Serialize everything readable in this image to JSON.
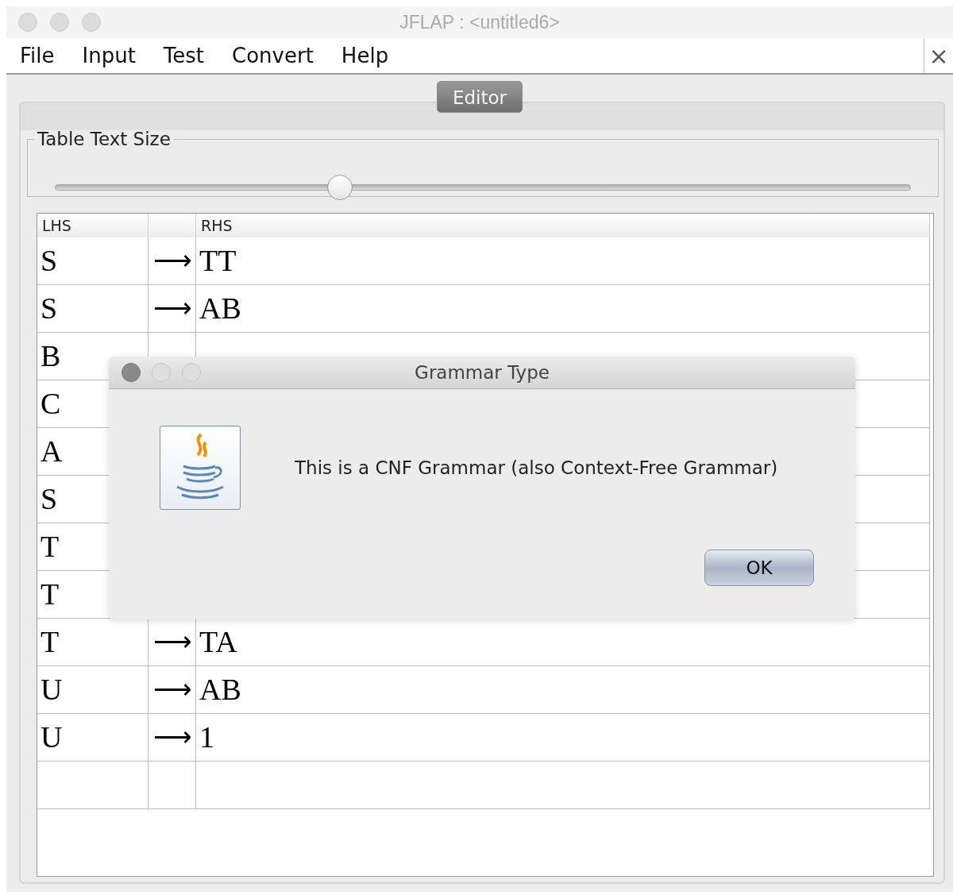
{
  "window": {
    "title": "JFLAP : <untitled6>",
    "close": "×"
  },
  "menu": [
    "File",
    "Input",
    "Test",
    "Convert",
    "Help"
  ],
  "tabs": [
    {
      "label": "Editor",
      "selected": true
    }
  ],
  "slider": {
    "label": "Table Text Size",
    "level": 0.333
  },
  "table": {
    "columns": [
      "LHS",
      "",
      "RHS"
    ],
    "rows": [
      {
        "lhs": "S",
        "arrow": "⟶",
        "rhs": "TT"
      },
      {
        "lhs": "S",
        "arrow": "⟶",
        "rhs": "AB"
      },
      {
        "lhs": "B"
      },
      {
        "lhs": "C"
      },
      {
        "lhs": "A"
      },
      {
        "lhs": "S"
      },
      {
        "lhs": "T"
      },
      {
        "lhs": "T"
      },
      {
        "lhs": "T",
        "arrow": "⟶",
        "rhs": "TA"
      },
      {
        "lhs": "U",
        "arrow": "⟶",
        "rhs": "AB"
      },
      {
        "lhs": "U",
        "arrow": "⟶",
        "rhs": "1"
      },
      {}
    ]
  },
  "dialog": {
    "title": "Grammar Type",
    "message": "This is a CNF Grammar (also Context-Free Grammar)",
    "buttons": [
      "OK"
    ]
  }
}
